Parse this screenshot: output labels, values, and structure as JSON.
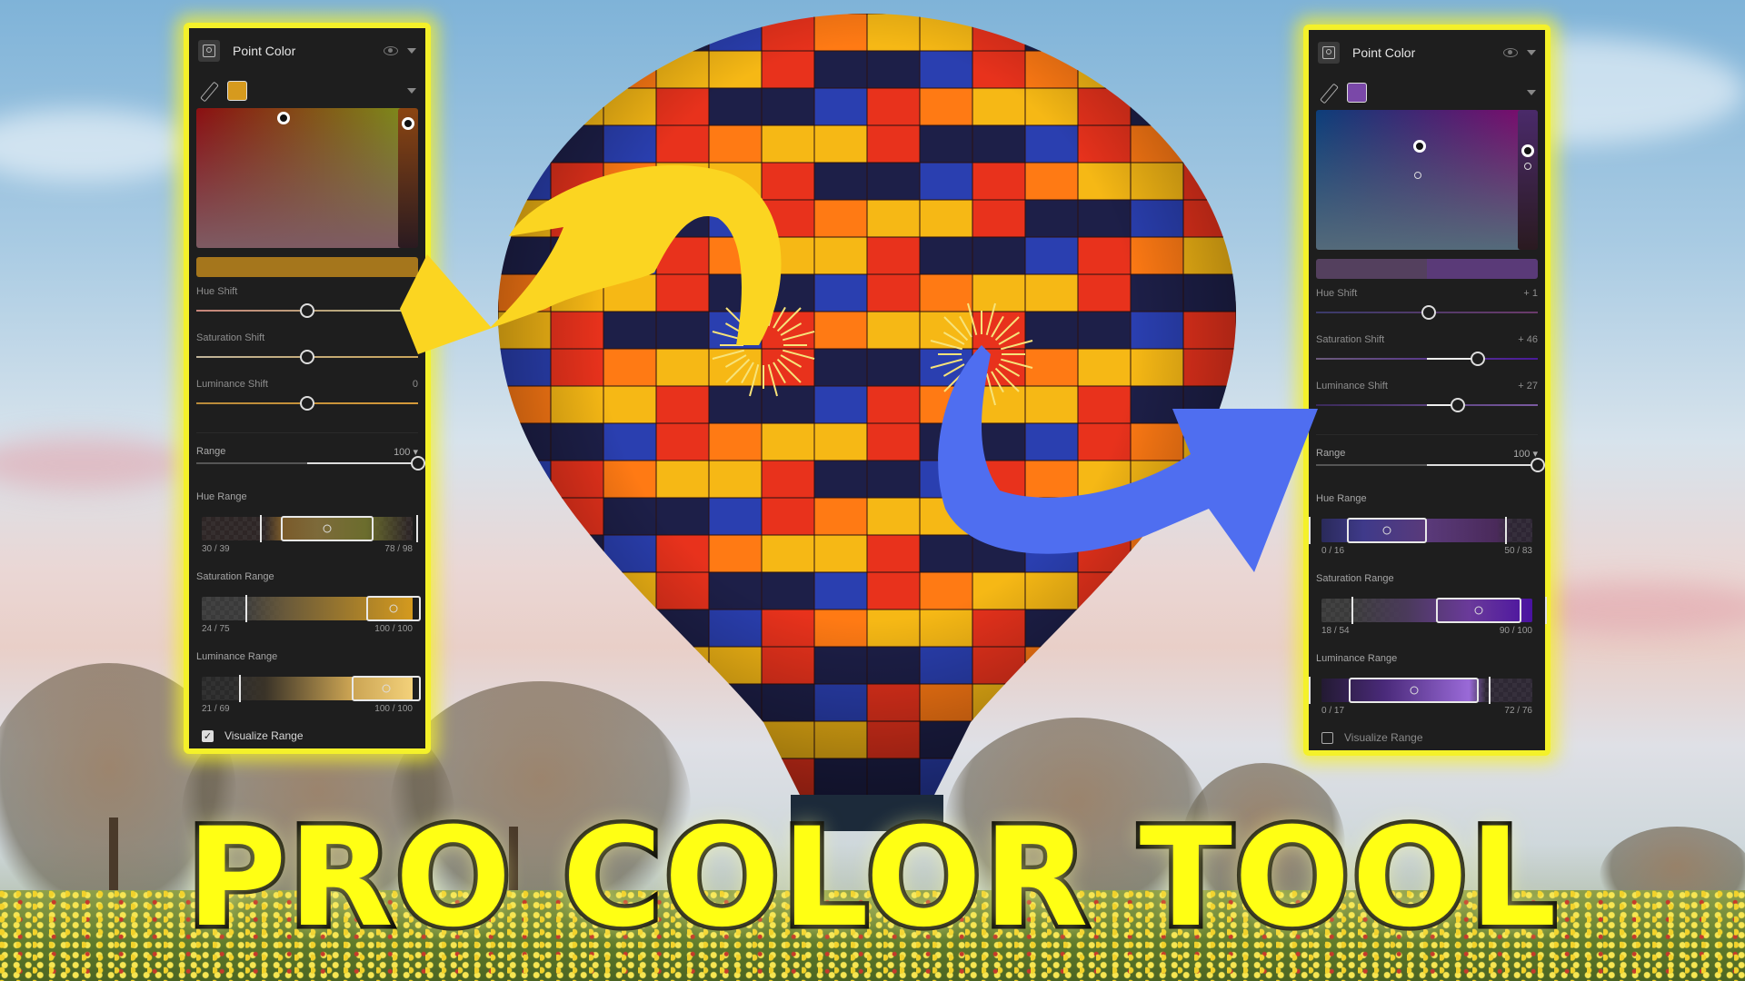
{
  "thumbnail": {
    "title": "PRO COLOR TOOL",
    "accent_color": "#f4f12a",
    "arrow_left_color": "#fbd521",
    "arrow_right_color": "#4f6ef0"
  },
  "panels": [
    {
      "id": "left",
      "title": "Point Color",
      "header_icons": [
        "point-color-icon",
        "eye-icon",
        "chevron-down-icon"
      ],
      "swatch_color": "#d69a1e",
      "picker_field_colors": [
        "#8b0f12",
        "#7d8a1a",
        "#7e5b63",
        "#7b8a4c"
      ],
      "strip_color": "#8b4512",
      "preview_color": "#a5761c",
      "hue_shift": {
        "label": "Hue Shift",
        "value": "",
        "position": 0.5
      },
      "saturation_shift": {
        "label": "Saturation Shift",
        "value": "",
        "position": 0.5
      },
      "luminance_shift": {
        "label": "Luminance Shift",
        "value": "0",
        "position": 0.5
      },
      "range": {
        "label": "Range",
        "value": "100",
        "position": 1.0
      },
      "hue_range": {
        "label": "Hue Range",
        "left": "30 / 39",
        "right": "78 / 98"
      },
      "saturation_range": {
        "label": "Saturation Range",
        "left": "24 / 75",
        "right": "100 / 100"
      },
      "luminance_range": {
        "label": "Luminance Range",
        "left": "21 / 69",
        "right": "100 / 100"
      },
      "visualize_range": {
        "label": "Visualize Range",
        "checked": true,
        "mark": "✓"
      }
    },
    {
      "id": "right",
      "title": "Point Color",
      "header_icons": [
        "point-color-icon",
        "eye-icon",
        "chevron-down-icon"
      ],
      "swatch_color": "#7a48a8",
      "picker_field_colors": [
        "#0c3e7a",
        "#7a0c6c",
        "#546a7a",
        "#7a4a6a"
      ],
      "strip_color": "#4a2a6a",
      "preview_color": "#5a3a78",
      "hue_shift": {
        "label": "Hue Shift",
        "value": "+ 1",
        "position": 0.51
      },
      "saturation_shift": {
        "label": "Saturation Shift",
        "value": "+ 46",
        "position": 0.73
      },
      "luminance_shift": {
        "label": "Luminance Shift",
        "value": "+ 27",
        "position": 0.64
      },
      "range": {
        "label": "Range",
        "value": "100",
        "position": 1.0
      },
      "hue_range": {
        "label": "Hue Range",
        "left": "0 / 16",
        "right": "50 / 83"
      },
      "saturation_range": {
        "label": "Saturation Range",
        "left": "18 / 54",
        "right": "90 / 100"
      },
      "luminance_range": {
        "label": "Luminance Range",
        "left": "0 / 17",
        "right": "72 / 76"
      },
      "visualize_range": {
        "label": "Visualize Range",
        "checked": false,
        "mark": ""
      }
    }
  ]
}
